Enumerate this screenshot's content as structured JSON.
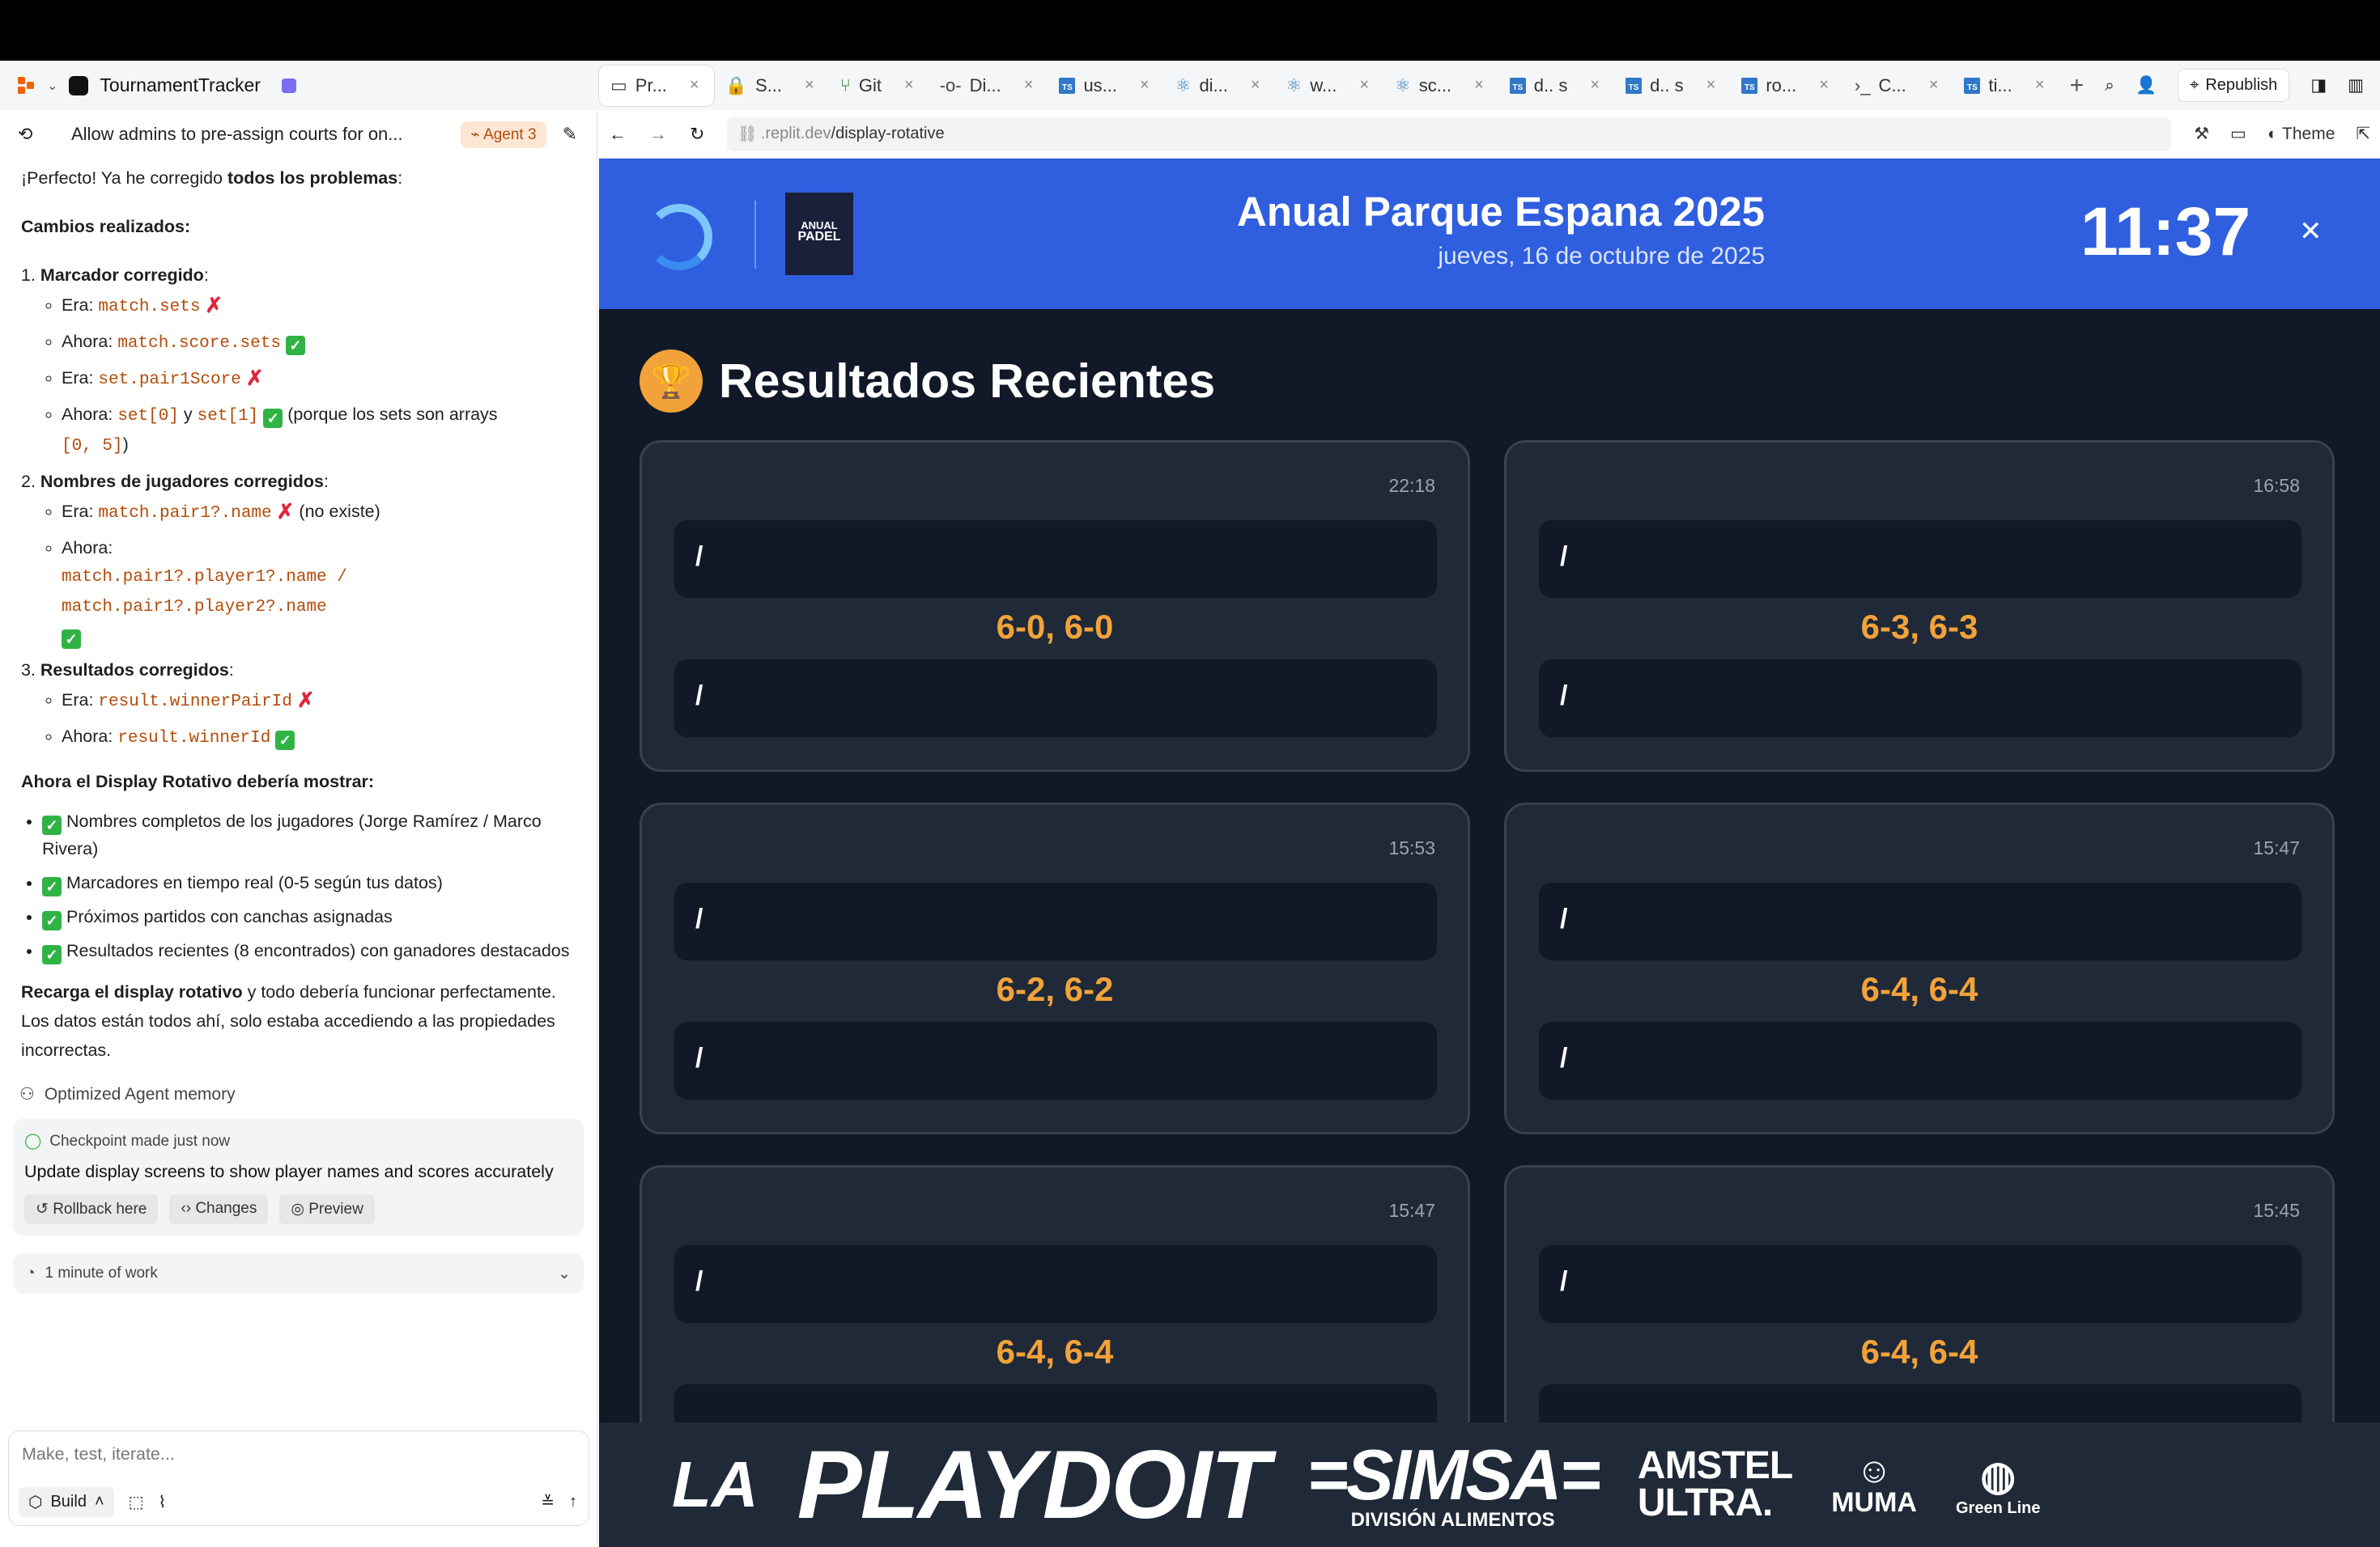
{
  "project": {
    "name": "TournamentTracker"
  },
  "tabs": [
    {
      "label": "Pr...",
      "icon": "monitor-icon",
      "active": true
    },
    {
      "label": "S...",
      "icon": "lock-icon"
    },
    {
      "label": "Git",
      "icon": "git-icon"
    },
    {
      "label": "Di...",
      "icon": "commit-icon"
    },
    {
      "label": "us...",
      "icon": "ts-icon"
    },
    {
      "label": "di...",
      "icon": "react-icon"
    },
    {
      "label": "w...",
      "icon": "react-icon"
    },
    {
      "label": "sc...",
      "icon": "react-icon"
    },
    {
      "label": "d.. s",
      "icon": "ts-icon"
    },
    {
      "label": "d.. s",
      "icon": "ts-icon"
    },
    {
      "label": "ro...",
      "icon": "ts-icon"
    },
    {
      "label": "C...",
      "icon": "terminal-icon"
    },
    {
      "label": "ti...",
      "icon": "ts-icon"
    }
  ],
  "topbar": {
    "republish": "Republish"
  },
  "chat": {
    "header_title": "Allow admins to pre-assign courts for on...",
    "agent_badge": "Agent 3",
    "intro_a": "¡Perfecto! Ya he corregido ",
    "intro_b": "todos los problemas",
    "intro_c": ":",
    "changes_title": "Cambios realizados:",
    "s1_title": "Marcador corregido",
    "s1": {
      "l1_pre": "Era: ",
      "l1_code": "match.sets",
      "l2_pre": "Ahora: ",
      "l2_code": "match.score.sets",
      "l3_pre": "Era: ",
      "l3_code": "set.pair1Score",
      "l4_pre": "Ahora: ",
      "l4_code_a": "set[0]",
      "l4_mid": " y ",
      "l4_code_b": "set[1]",
      "l4_post": "(porque los sets son arrays",
      "l4_code_c": "[0, 5]",
      "l4_end": ")"
    },
    "s2_title": "Nombres de jugadores corregidos",
    "s2": {
      "l1_pre": "Era: ",
      "l1_code": "match.pair1?.name",
      "l1_post": "(no existe)",
      "l2_pre": "Ahora:",
      "l2_code_a": "match.pair1?.player1?.name /",
      "l2_code_b": "match.pair1?.player2?.name"
    },
    "s3_title": "Resultados corregidos",
    "s3": {
      "l1_pre": "Era: ",
      "l1_code": "result.winnerPairId",
      "l2_pre": "Ahora: ",
      "l2_code": "result.winnerId"
    },
    "display_title": "Ahora el Display Rotativo debería mostrar:",
    "display_items": [
      "Nombres completos de los jugadores (Jorge Ramírez / Marco Rivera)",
      "Marcadores en tiempo real (0-5 según tus datos)",
      "Próximos partidos con canchas asignadas",
      "Resultados recientes (8 encontrados) con ganadores destacados"
    ],
    "outro_b": "Recarga el display rotativo",
    "outro_rest": " y todo debería funcionar perfectamente. Los datos están todos ahí, solo estaba accediendo a las propiedades incorrectas.",
    "memory": "Optimized Agent memory",
    "checkpoint_label": "Checkpoint made just now",
    "checkpoint_text": "Update display screens to show player names and scores accurately",
    "btn_rollback": "Rollback here",
    "btn_changes": "Changes",
    "btn_preview": "Preview",
    "work": "1 minute of work",
    "input_placeholder": "Make, test, iterate...",
    "build": "Build"
  },
  "preview": {
    "url_dim": ".replit.dev",
    "url_path": "/display-rotative",
    "theme": "Theme"
  },
  "display": {
    "title": "Anual Parque Espana 2025",
    "date": "jueves, 16 de octubre de 2025",
    "clock": "11:37",
    "badge_a": "ANUAL",
    "badge_b": "PADEL",
    "section": "Resultados Recientes",
    "results": [
      {
        "time": "22:18",
        "pair1": "/",
        "pair2": "/",
        "score": "6-0, 6-0"
      },
      {
        "time": "16:58",
        "pair1": "/",
        "pair2": "/",
        "score": "6-3, 6-3"
      },
      {
        "time": "15:53",
        "pair1": "/",
        "pair2": "/",
        "score": "6-2, 6-2"
      },
      {
        "time": "15:47",
        "pair1": "/",
        "pair2": "/",
        "score": "6-4, 6-4"
      },
      {
        "time": "15:47",
        "pair1": "/",
        "pair2": "",
        "score": "6-4, 6-4"
      },
      {
        "time": "15:45",
        "pair1": "/",
        "pair2": "",
        "score": "6-4, 6-4"
      }
    ],
    "sponsors": {
      "la": "LA",
      "playdoit": "PLAYDOIT",
      "simsa": "=SIMSA=",
      "simsa_sub": "DIVISIÓN ALIMENTOS",
      "amstel_a": "AMSTEL",
      "amstel_b": "ULTRA.",
      "muma": "MUMA",
      "greenline": "Green Line"
    }
  }
}
